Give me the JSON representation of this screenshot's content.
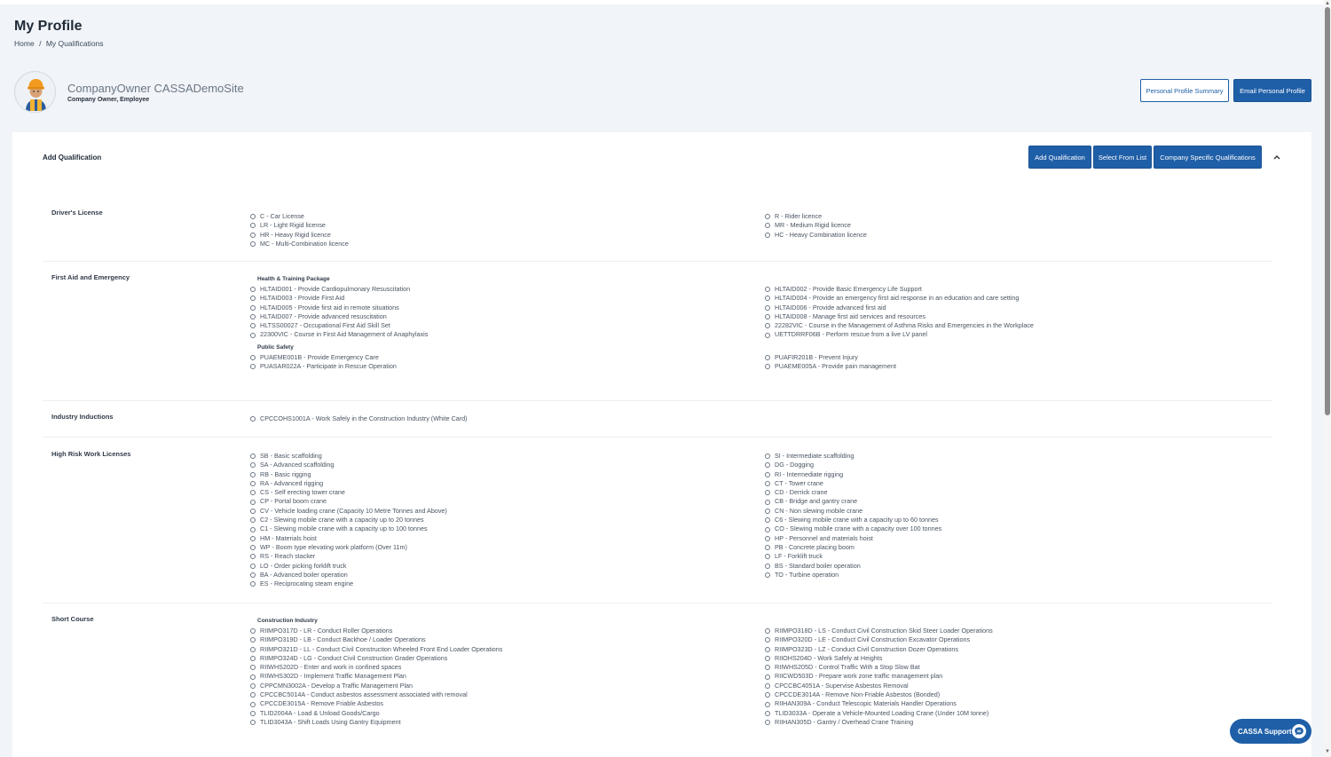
{
  "page": {
    "title": "My Profile",
    "breadcrumb": {
      "home": "Home",
      "separator": "/",
      "current": "My Qualifications"
    }
  },
  "profile": {
    "name": "CompanyOwner CASSADemoSite",
    "role": "Company Owner, Employee",
    "avatar_icon": "worker-avatar-icon",
    "summary_button": "Personal Profile Summary",
    "email_button": "Email Personal Profile"
  },
  "qualification": {
    "title": "Add Qualification",
    "add_button": "Add Qualification",
    "select_button": "Select From List",
    "company_button": "Company Specific Qualifications",
    "collapse_icon": "chevron-up-icon"
  },
  "sections": {
    "drivers": {
      "label": "Driver's License",
      "left": [
        "C - Car License",
        "LR - Light Rigid license",
        "HR - Heavy Rigid licence",
        "MC - Multi-Combination licence"
      ],
      "right": [
        "R - Rider licence",
        "MR - Medium Rigid licence",
        "HC - Heavy Combination licence"
      ]
    },
    "first_aid": {
      "label": "First Aid and Emergency",
      "group1": "Health & Training Package",
      "left1": [
        "HLTAID001 - Provide Cardiopulmonary Resuscitation",
        "HLTAID003 - Provide First Aid",
        "HLTAID005 - Provide first aid in remote situations",
        "HLTAID007 - Provide advanced resuscitation",
        "HLTSS00027 - Occupational First Aid Skill Set",
        "22300VIC - Course in First Aid Management of Anaphylaxis"
      ],
      "right1": [
        "HLTAID002 - Provide Basic Emergency Life Support",
        "HLTAID004 - Provide an emergency first aid response in an education and care setting",
        "HLTAID006 - Provide advanced first aid",
        "HLTAID008 - Manage first aid services and resources",
        "22282VIC - Course in the Management of Asthma Risks and Emergencies in the Workplace",
        "UETTDRRF06B - Perform rescue from a live LV panel"
      ],
      "group2": "Public Safety",
      "left2": [
        "PUAEME001B - Provide Emergency Care",
        "PUASAR022A - Participate in Rescue Operation"
      ],
      "right2": [
        "PUAFIR201B - Prevent Injury",
        "PUAEME005A - Provide pain management"
      ]
    },
    "inductions": {
      "label": "Industry Inductions",
      "left": [
        "CPCCOHS1001A - Work Safely in the Construction Industry (White Card)"
      ]
    },
    "high_risk": {
      "label": "High Risk Work Licenses",
      "left": [
        "SB - Basic scaffolding",
        "SA - Advanced scaffolding",
        "RB - Basic rigging",
        "RA - Advanced rigging",
        "CS - Self erecting tower crane",
        "CP - Portal boom crane",
        "CV - Vehicle loading crane (Capacity 10 Metre Tonnes and Above)",
        "C2 - Slewing mobile crane with a capacity up to 20 tonnes",
        "C1 - Slewing mobile crane with a capacity up to 100 tonnes",
        "HM - Materials hoist",
        "WP - Boom type elevating work platform (Over 11m)",
        "RS - Reach stacker",
        "LO - Order picking forklift truck",
        "BA - Advanced boiler operation",
        "ES - Reciprocating steam engine"
      ],
      "right": [
        "SI - Intermediate scaffolding",
        "DG - Dogging",
        "RI - Intermediate rigging",
        "CT - Tower crane",
        "CD - Derrick crane",
        "CB - Bridge and gantry crane",
        "CN - Non slewing mobile crane",
        "C6 - Slewing mobile crane with a capacity up to 60 tonnes",
        "CO - Slewing mobile crane with a capacity over 100 tonnes",
        "HP - Personnel and materials hoist",
        "PB - Concrete placing boom",
        "LF - Forklift truck",
        "BS - Standard boiler operation",
        "TO - Turbine operation"
      ]
    },
    "short_course": {
      "label": "Short Course",
      "group1": "Construction Industry",
      "left": [
        "RIIMPO317D - LR - Conduct Roller Operations",
        "RIIMPO319D - LB - Conduct Backhoe / Loader Operations",
        "RIIMPO321D - LL - Conduct Civil Construction Wheeled Front End Loader Operations",
        "RIIMPO324D - LG - Conduct Civil Construction Grader Operations",
        "RIIWHS202D - Enter and work in confined spaces",
        "RIIWHS302D - Implement Traffic Management Plan",
        "CPPCMN3002A - Develop a Traffic Management Plan",
        "CPCCBC5014A - Conduct asbestos assessment associated with removal",
        "CPCCDE3015A - Remove Friable Asbestos",
        "TLID2004A - Load & Unload Goods/Cargo",
        "TLID3043A - Shift Loads Using Gantry Equipment"
      ],
      "right": [
        "RIIMPO318D - LS - Conduct Civil Construction Skid Steer Loader Operations",
        "RIIMPO320D - LE - Conduct Civil Construction Excavator Operations",
        "RIIMPO323D - LZ - Conduct Civil Construction Dozer Operations",
        "RIIOHS204D - Work Safely at Heights",
        "RIIWHS205D - Control Traffic With a Stop Slow Bat",
        "RIICWD503D - Prepare work zone traffic management plan",
        "CPCCBC4051A - Supervise Asbestos Removal",
        "CPCCDE3014A - Remove Non-Friable Asbestos (Bonded)",
        "RIIHAN309A - Conduct Telescopic Materials Handler Operations",
        "TLID3033A - Operate a Vehicle-Mounted Loading Crane (Under 10M tonne)",
        "RIIHAN305D - Gantry / Overhead Crane Training"
      ]
    }
  },
  "support": {
    "label": "CASSA Support",
    "icon": "chat-bubble-icon"
  },
  "colors": {
    "primary": "#1f5fa8",
    "background": "#f1f4f8"
  }
}
